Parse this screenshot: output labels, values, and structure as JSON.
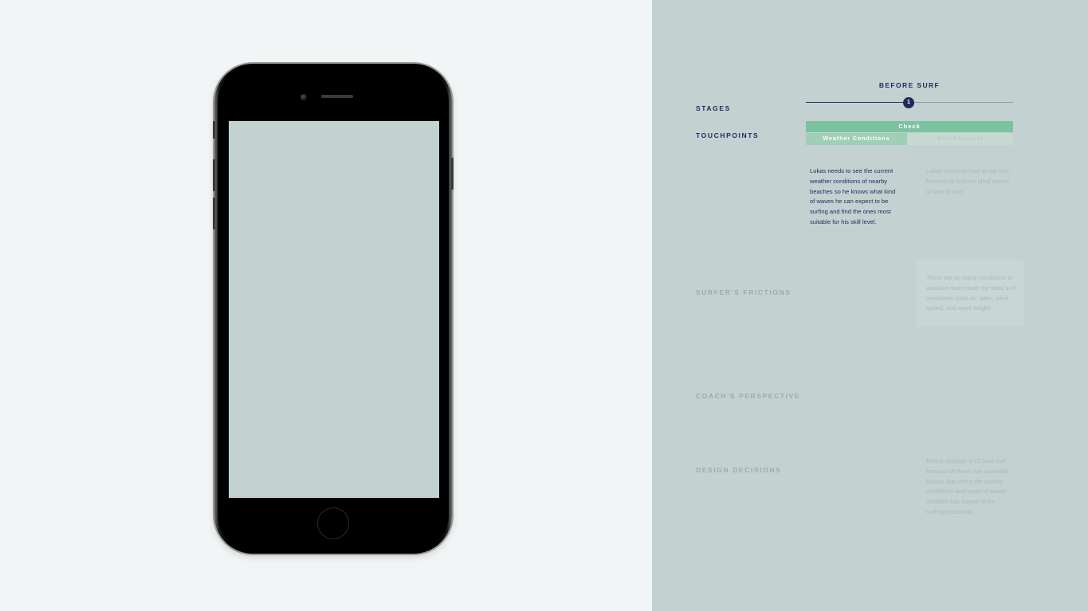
{
  "journey": {
    "stage_title": "BEFORE SURF",
    "stage_number": "1",
    "labels": {
      "stages": "STAGES",
      "touchpoints": "TOUCHPOINTS",
      "frictions": "SURFER'S FRICTIONS",
      "coach": "COACH'S PERSPECTIVE",
      "design": "DESIGN DECISIONS"
    },
    "touchpoints": {
      "main": "Check",
      "sub": [
        "Weather Conditions",
        "Surf Forecast"
      ]
    },
    "needs": [
      "Lukas needs to see the current weather conditions of nearby beaches so he knows what kind of waves he can expect to be surfing and find the ones most suitable for his skill level.",
      "Lukas needs to look at the surf forecast to find the ideal period of time to surf."
    ],
    "friction_text": "There are so many conditions to consider that create the ideal surf conditions such as: tides, wind speed, and wave height.",
    "design_text": "Beach displays a 72 hour surf forecast of these five essential factors that affect the surfing conditions and types of waves Stephen can expect to be surfing/practicing."
  },
  "colors": {
    "navy": "#1f2a5c",
    "accent_green": "#7cc2a0",
    "panel_bg": "#c3d1d1",
    "page_bg": "#f2f5f6"
  }
}
